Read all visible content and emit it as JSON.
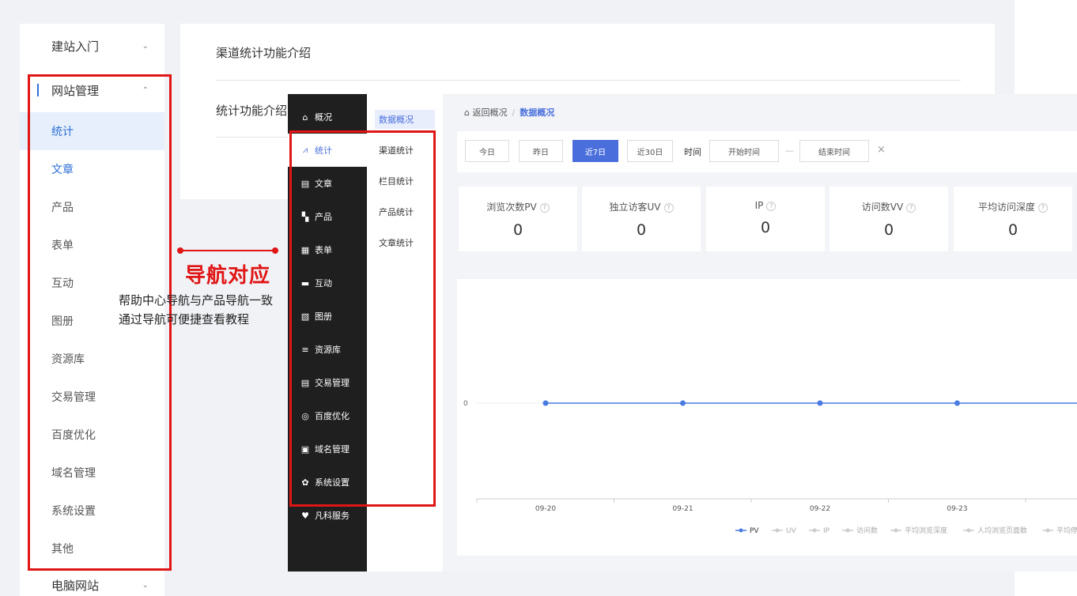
{
  "help_nav": {
    "groups": [
      {
        "label": "建站入门",
        "chevron": "⌄"
      },
      {
        "label": "网站管理",
        "chevron": "⌃"
      }
    ],
    "items": [
      "统计",
      "文章",
      "产品",
      "表单",
      "互动",
      "图册",
      "资源库",
      "交易管理",
      "百度优化",
      "域名管理",
      "系统设置",
      "其他"
    ],
    "bottom_group": {
      "label": "电脑网站",
      "chevron": "⌄"
    }
  },
  "content": {
    "title": "渠道统计功能介绍",
    "subtitle": "统计功能介绍"
  },
  "annotation": {
    "title": "导航对应",
    "line1": "帮助中心导航与产品导航一致",
    "line2": "通过导航可便捷查看教程",
    "color": "#e01515"
  },
  "app": {
    "main_nav": [
      {
        "label": "概况",
        "icon": "home-icon",
        "glyph": "⌂"
      },
      {
        "label": "统计",
        "icon": "stats-icon",
        "glyph": "⩘"
      },
      {
        "label": "文章",
        "icon": "article-icon",
        "glyph": "▤"
      },
      {
        "label": "产品",
        "icon": "product-icon",
        "glyph": "▚"
      },
      {
        "label": "表单",
        "icon": "form-icon",
        "glyph": "▦"
      },
      {
        "label": "互动",
        "icon": "chat-icon",
        "glyph": "▬"
      },
      {
        "label": "图册",
        "icon": "album-icon",
        "glyph": "▧"
      },
      {
        "label": "资源库",
        "icon": "database-icon",
        "glyph": "≡"
      },
      {
        "label": "交易管理",
        "icon": "trade-icon",
        "glyph": "▤"
      },
      {
        "label": "百度优化",
        "icon": "seo-icon",
        "glyph": "◎"
      },
      {
        "label": "域名管理",
        "icon": "domain-icon",
        "glyph": "▣"
      },
      {
        "label": "系统设置",
        "icon": "gear-icon",
        "glyph": "✿"
      },
      {
        "label": "凡科服务",
        "icon": "heart-icon",
        "glyph": "♥"
      }
    ],
    "sub_nav": [
      "数据概况",
      "渠道统计",
      "栏目统计",
      "产品统计",
      "文章统计"
    ],
    "breadcrumb": {
      "back": "返回概况",
      "separator": "/",
      "current": "数据概况"
    },
    "filters": {
      "ranges": [
        "今日",
        "昨日",
        "近7日",
        "近30日"
      ],
      "selected": "近7日",
      "time_label": "时间",
      "start_placeholder": "开始时间",
      "dash": "—",
      "end_placeholder": "结束时间",
      "clear": "×"
    },
    "stats": [
      {
        "label": "浏览次数PV",
        "value": "0"
      },
      {
        "label": "独立访客UV",
        "value": "0"
      },
      {
        "label": "IP",
        "value": "0"
      },
      {
        "label": "访问数VV",
        "value": "0"
      },
      {
        "label": "平均访问深度",
        "value": "0"
      }
    ],
    "accent": "#4a6fdc"
  },
  "chart_data": {
    "type": "line",
    "x": [
      "09-20",
      "09-21",
      "09-22",
      "09-23"
    ],
    "series": [
      {
        "name": "PV",
        "values": [
          0,
          0,
          0,
          0
        ]
      }
    ],
    "y_ticks": [
      "0"
    ],
    "legend": [
      "PV",
      "UV",
      "IP",
      "访问数",
      "平均浏览深度",
      "人均浏览页面数",
      "平均停"
    ],
    "legend_placement": "bottom-right",
    "series_color": "#4a7be0"
  }
}
